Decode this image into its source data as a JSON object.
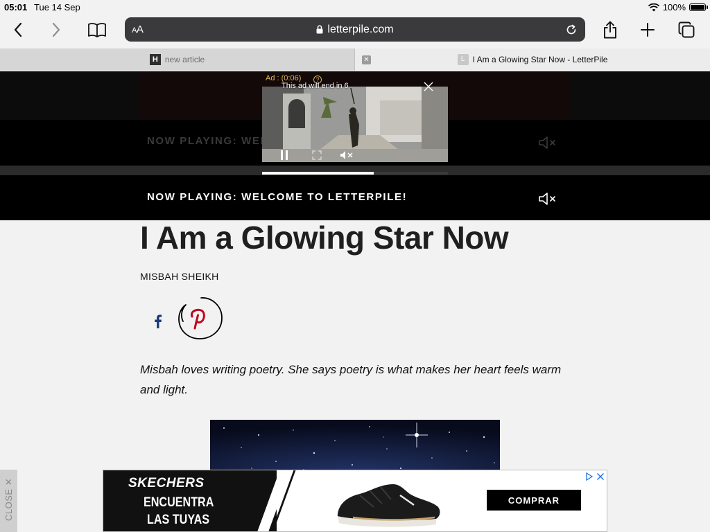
{
  "status": {
    "time": "05:01",
    "date": "Tue 14 Sep",
    "battery": "100%"
  },
  "toolbar": {
    "aa": "AA",
    "url": "letterpile.com"
  },
  "tabs": [
    {
      "label": "new article",
      "favicon": "H"
    },
    {
      "label": "I Am a Glowing Star Now - LetterPile",
      "favicon": "L"
    }
  ],
  "now_playing": {
    "label": "NOW PLAYING: WELCOME TO LETTERPILE!",
    "label_partial": "NOW PLAYING: WEL"
  },
  "ad_video": {
    "label": "Ad : (0:06)",
    "countdown": "This ad will end in 6",
    "progress": 0.6
  },
  "article": {
    "title": "I Am a Glowing Star Now",
    "author": "MISBAH SHEIKH",
    "summary": "Misbah loves writing poetry. She says poetry is what makes her heart feels warm and light."
  },
  "bottom_ad": {
    "close_label": "CLOSE",
    "brand": "SKECHERS",
    "slogan_line1": "ENCUENTRA",
    "slogan_line2": "LAS TUYAS",
    "cta": "COMPRAR"
  },
  "colors": {
    "pinterest": "#bd081c",
    "facebook": "#1b3a78",
    "address_bar": "#3a3a3c"
  }
}
